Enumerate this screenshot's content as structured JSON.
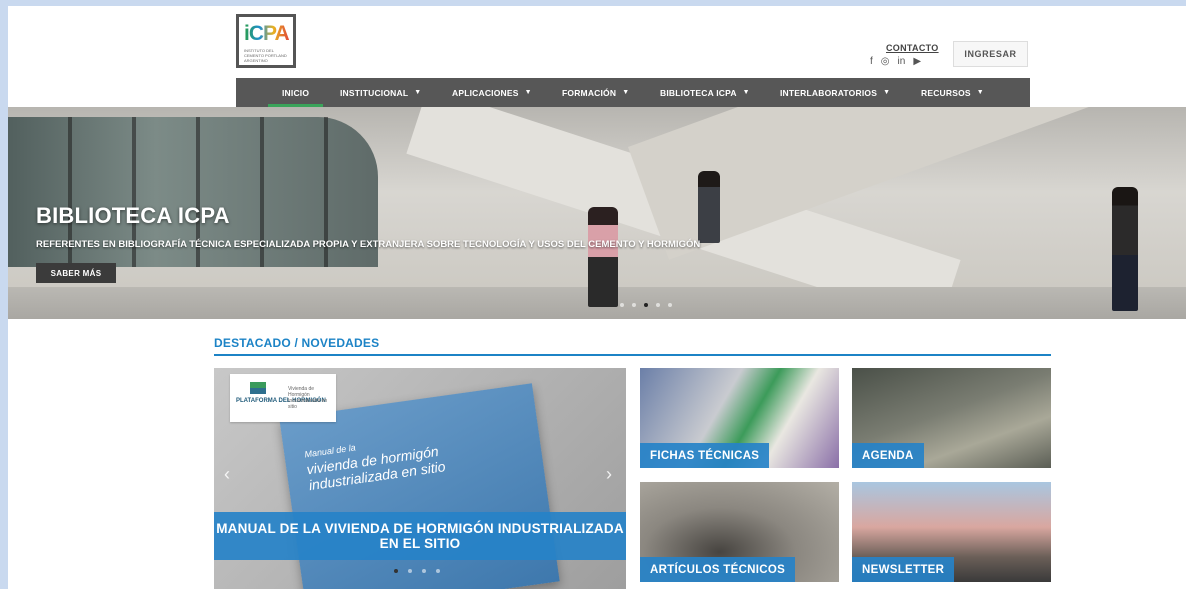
{
  "header": {
    "logo_text": "iCPA",
    "logo_subtitle": "INSTITUTO DEL CEMENTO PORTLAND ARGENTINO",
    "contact_label": "CONTACTO",
    "login_label": "INGRESAR",
    "social": [
      {
        "icon": "facebook-icon",
        "glyph": "f"
      },
      {
        "icon": "instagram-icon",
        "glyph": "◎"
      },
      {
        "icon": "linkedin-icon",
        "glyph": "in"
      },
      {
        "icon": "youtube-icon",
        "glyph": "▶"
      }
    ]
  },
  "nav": {
    "items": [
      {
        "label": "INICIO",
        "dropdown": false,
        "active": true
      },
      {
        "label": "INSTITUCIONAL",
        "dropdown": true,
        "active": false
      },
      {
        "label": "APLICACIONES",
        "dropdown": true,
        "active": false
      },
      {
        "label": "FORMACIÓN",
        "dropdown": true,
        "active": false
      },
      {
        "label": "BIBLIOTECA ICPA",
        "dropdown": true,
        "active": false
      },
      {
        "label": "INTERLABORATORIOS",
        "dropdown": true,
        "active": false
      },
      {
        "label": "RECURSOS",
        "dropdown": true,
        "active": false
      }
    ],
    "caret": "▼"
  },
  "hero": {
    "title": "BIBLIOTECA ICPA",
    "subtitle": "REFERENTES EN BIBLIOGRAFÍA TÉCNICA ESPECIALIZADA PROPIA Y EXTRANJERA SOBRE TECNOLOGÍA Y USOS DEL CEMENTO Y HORMIGÓN",
    "button_label": "SABER MÁS",
    "slide_count": 5,
    "active_slide": 3
  },
  "featured": {
    "section_title": "DESTACADO / NOVEDADES",
    "slider": {
      "logo_title": "PLATAFORMA DEL HORMIGÓN",
      "logo_desc": "Vivienda de Hormigón Industrializada en sitio",
      "book_small": "Manual de la",
      "book_title": "vivienda de hormigón industrializada en sitio",
      "caption": "MANUAL DE LA VIVIENDA DE HORMIGÓN INDUSTRIALIZADA EN EL SITIO",
      "prev_glyph": "‹",
      "next_glyph": "›",
      "slide_count": 4,
      "active_slide": 1
    },
    "tiles": [
      {
        "label": "FICHAS TÉCNICAS"
      },
      {
        "label": "AGENDA"
      },
      {
        "label": "ARTÍCULOS TÉCNICOS"
      },
      {
        "label": "NEWSLETTER"
      }
    ]
  },
  "colors": {
    "accent_blue": "#1c83c6",
    "nav_bg": "#575757",
    "nav_active": "#3aa45a"
  }
}
